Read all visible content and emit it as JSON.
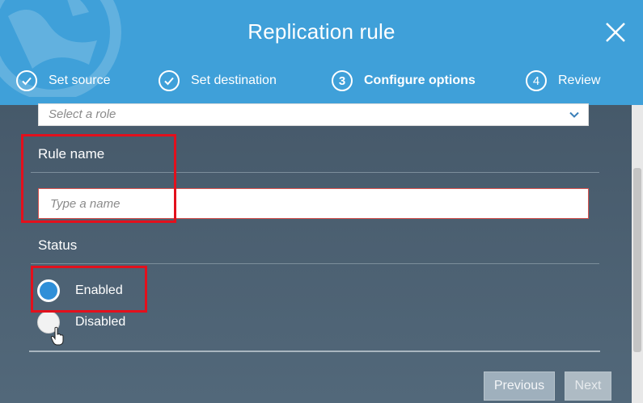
{
  "header": {
    "title": "Replication rule",
    "steps": [
      {
        "number": "",
        "label": "Set source",
        "state": "done"
      },
      {
        "number": "",
        "label": "Set destination",
        "state": "done"
      },
      {
        "number": "3",
        "label": "Configure options",
        "state": "active"
      },
      {
        "number": "4",
        "label": "Review",
        "state": "pending"
      }
    ]
  },
  "form": {
    "role_select": {
      "placeholder": "Select a role"
    },
    "rule_name": {
      "label": "Rule name",
      "placeholder": "Type a name"
    },
    "status": {
      "label": "Status",
      "options": [
        {
          "label": "Enabled",
          "selected": true
        },
        {
          "label": "Disabled",
          "selected": false
        }
      ]
    }
  },
  "footer": {
    "previous_label": "Previous",
    "next_label": "Next"
  },
  "colors": {
    "header_bg": "#3fa0d9",
    "panel_bg": "#4a5d6e",
    "highlight": "#e3101c",
    "radio_selected": "#2f8fd8"
  }
}
